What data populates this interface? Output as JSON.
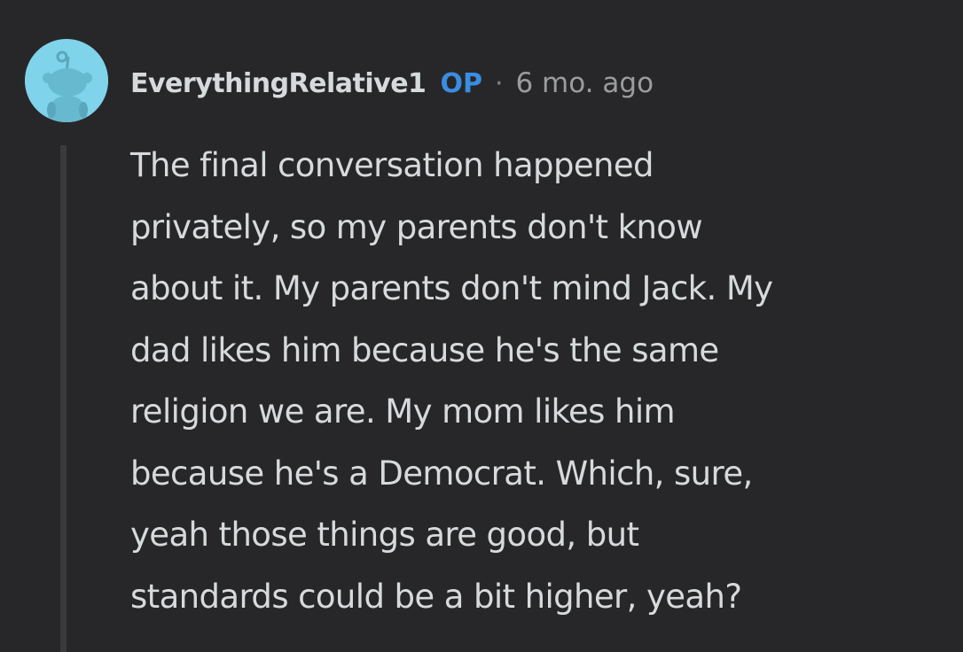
{
  "comment": {
    "author": "EverythingRelative1",
    "badge": "OP",
    "separator": "·",
    "timestamp": "6 mo. ago",
    "avatar_icon": "reddit-snoo-avatar-icon",
    "avatar_color": "#7fd3ea",
    "body_lines": [
      "The final conversation happened",
      "privately, so my parents don't know",
      "about it. My parents don't mind Jack. My",
      "dad likes him because he's the same",
      "religion we are. My mom likes him",
      "because he's a Democrat. Which, sure,",
      "yeah those things are good, but",
      "standards could be a bit higher, yeah?"
    ]
  },
  "colors": {
    "background": "#272729",
    "text": "#d7dadc",
    "op_badge": "#3a8de0",
    "meta": "#9a9c9e",
    "thread_line": "#3a3a3c"
  }
}
